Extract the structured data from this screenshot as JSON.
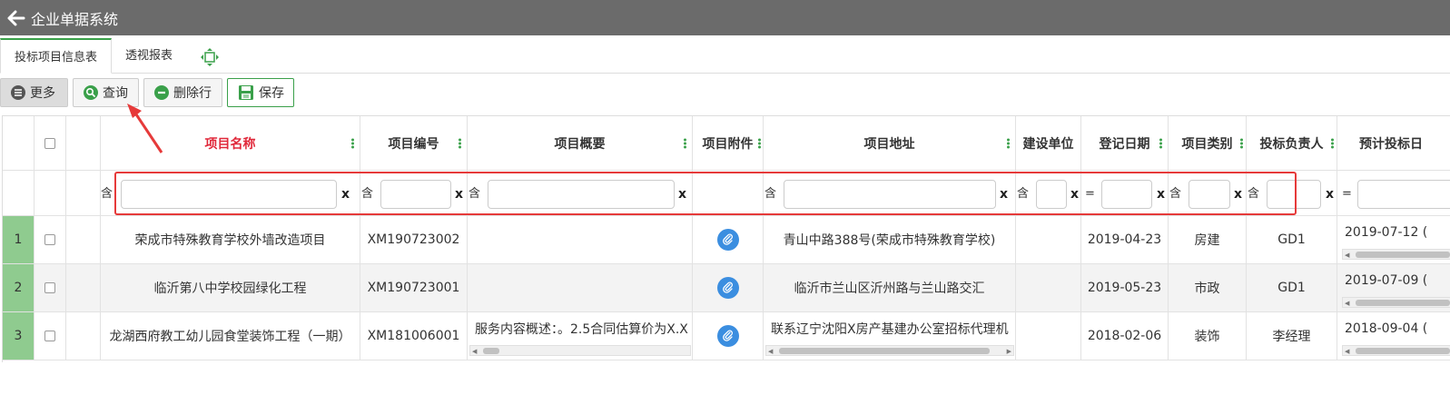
{
  "titlebar": {
    "title": "企业单据系统"
  },
  "tabs": [
    {
      "label": "投标项目信息表"
    },
    {
      "label": "透视报表"
    }
  ],
  "toolbar": {
    "more": "更多",
    "query": "查询",
    "delete_row": "删除行",
    "save": "保存"
  },
  "columns": {
    "project_name": "项目名称",
    "project_no": "项目编号",
    "summary": "项目概要",
    "attachment": "项目附件",
    "address": "项目地址",
    "builder": "建设单位",
    "reg_date": "登记日期",
    "category": "项目类别",
    "owner": "投标负责人",
    "bid_date": "预计投标日"
  },
  "filters": {
    "contains": "含",
    "equals": "=",
    "clear": "x"
  },
  "rows": [
    {
      "num": "1",
      "name": "荣成市特殊教育学校外墙改造项目",
      "no": "XM190723002",
      "summary": "",
      "address": "青山中路388号(荣成市特殊教育学校)",
      "builder": "",
      "date": "2019-04-23",
      "category": "房建",
      "owner": "GD1",
      "bid_date": "2019-07-12 ("
    },
    {
      "num": "2",
      "name": "临沂第八中学校园绿化工程",
      "no": "XM190723001",
      "summary": "",
      "address": "临沂市兰山区沂州路与兰山路交汇",
      "builder": "",
      "date": "2019-05-23",
      "category": "市政",
      "owner": "GD1",
      "bid_date": "2019-07-09 ("
    },
    {
      "num": "3",
      "name": "龙湖西府教工幼儿园食堂装饰工程（一期）",
      "no": "XM181006001",
      "summary": "服务内容概述：。2.5合同估算价为X.X",
      "address": "联系辽宁沈阳X房产基建办公室招标代理机",
      "builder": "",
      "date": "2018-02-06",
      "category": "装饰",
      "owner": "李经理",
      "bid_date": "2018-09-04 ("
    }
  ],
  "colors": {
    "accent": "#3aa04a",
    "rownum_bg": "#8fcb8f",
    "highlight": "#e63a3a",
    "attach": "#3b8ee0",
    "titlebar": "#6b6b6b"
  }
}
